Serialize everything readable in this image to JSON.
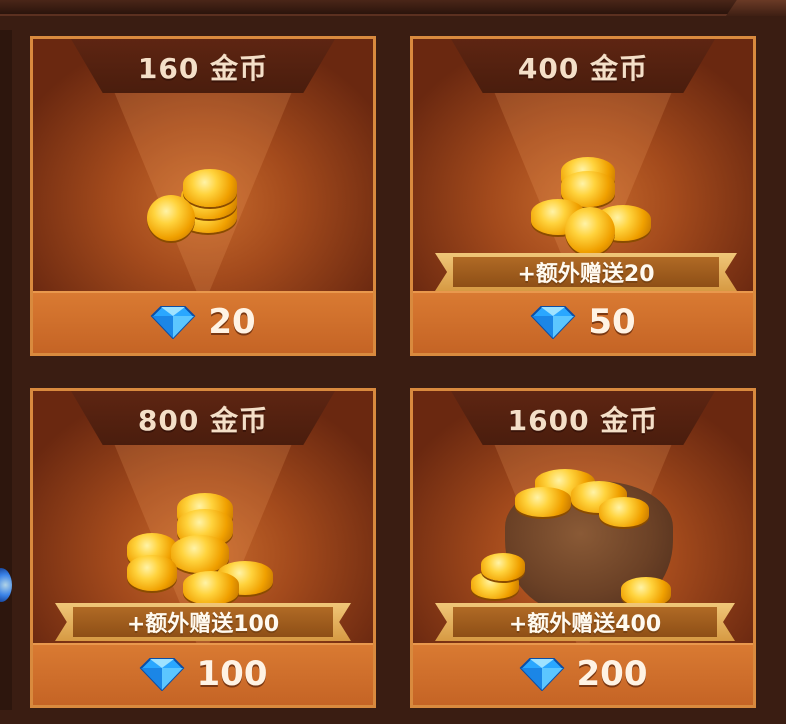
{
  "store": {
    "items": [
      {
        "title": "160 金币",
        "price": "20",
        "bonus": ""
      },
      {
        "title": "400 金币",
        "price": "50",
        "bonus": "+额外赠送20"
      },
      {
        "title": "800 金币",
        "price": "100",
        "bonus": "+额外赠送100"
      },
      {
        "title": "1600 金币",
        "price": "200",
        "bonus": "+额外赠送400"
      }
    ]
  },
  "icons": {
    "currency": "gem-icon",
    "product": "gold-coin-icon"
  },
  "colors": {
    "card_border": "#d98a3e",
    "footer": "#c56425",
    "gem": "#2aa7ff"
  }
}
